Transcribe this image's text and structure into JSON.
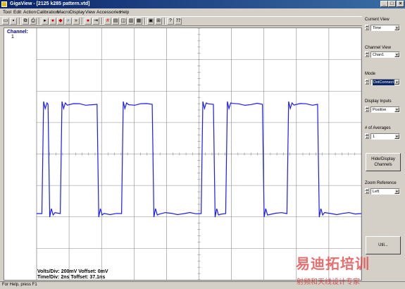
{
  "window": {
    "title": "GigaView - [2125 k285 pattern.vtd]"
  },
  "menu": [
    "Tool",
    "Edit",
    "Action",
    "Calibration",
    "Macro",
    "Display",
    "View",
    "Accessories",
    "Help"
  ],
  "toolbar": {
    "buttons": [
      "open-icon",
      "save-icon",
      "copy-icon",
      "print-icon",
      "run-icon",
      "stop-icon",
      "single-icon",
      "zoom-icon",
      "forward-icon",
      "record-icon",
      "step-icon",
      "grid-icon",
      "scale-icon",
      "marker-icon",
      "clear-icon",
      "fit-icon",
      "setup-icon",
      "probe-icon",
      "help-icon",
      "context-help-icon"
    ]
  },
  "scope": {
    "channel_label": "Channel:",
    "channel_number": "1",
    "readout_line1": "Volts/Div: 200mV Voffset: 0mV",
    "readout_line2": "Time/Div: 2ns Toffset: 37.1ns",
    "trace_color": "#1a1aff",
    "pattern_bits": [
      0,
      1,
      0,
      0,
      1,
      1,
      1,
      1,
      1,
      1,
      0,
      0,
      0,
      0,
      1,
      1,
      1,
      1,
      1,
      0,
      0,
      0,
      0,
      0,
      0,
      0,
      0,
      1,
      1,
      0,
      0,
      1,
      1,
      1,
      1,
      1,
      1,
      0,
      0,
      0,
      0,
      1,
      1,
      1,
      1,
      1,
      0,
      0,
      0,
      0,
      0,
      0,
      0
    ]
  },
  "panel": {
    "current_view_label": "Current View",
    "current_view_value": "Time",
    "channel_view_label": "Channel View",
    "channel_view_value": "Chan1",
    "mode_label": "Mode",
    "mode_value": "DotConnect",
    "display_inputs_label": "Display Inputs",
    "display_inputs_value": "Positive",
    "averages_label": "# of Averages",
    "averages_value": "1",
    "hide_display_label": "Hide/Display Channels",
    "zoom_ref_label": "Zoom Reference",
    "zoom_ref_value": "Left",
    "bottom_button_label": "Util..."
  },
  "status": {
    "text": "For Help, press F1"
  },
  "watermark": {
    "line1": "易迪拓培训",
    "line2": "射频和天线设计专家"
  }
}
